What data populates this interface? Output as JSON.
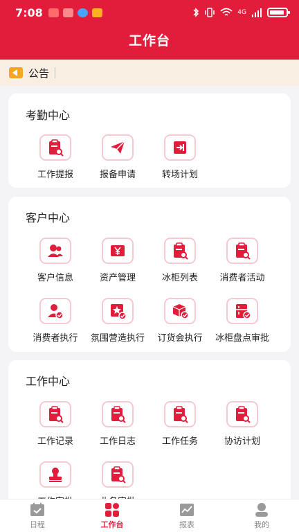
{
  "status": {
    "time": "7:08",
    "network": "4G"
  },
  "header": {
    "title": "工作台"
  },
  "notice": {
    "label": "公告"
  },
  "sections": {
    "attendance": {
      "title": "考勤中心",
      "items": [
        {
          "label": "工作提报",
          "icon": "clipboard-search-icon"
        },
        {
          "label": "报备申请",
          "icon": "paper-plane-icon"
        },
        {
          "label": "转场计划",
          "icon": "transfer-door-icon"
        }
      ]
    },
    "customer": {
      "title": "客户中心",
      "items": [
        {
          "label": "客户信息",
          "icon": "users-icon"
        },
        {
          "label": "资产管理",
          "icon": "yen-asset-icon"
        },
        {
          "label": "冰柜列表",
          "icon": "clipboard-search-icon"
        },
        {
          "label": "消费者活动",
          "icon": "clipboard-search-icon"
        },
        {
          "label": "消费者执行",
          "icon": "user-check-icon"
        },
        {
          "label": "氛围营造执行",
          "icon": "star-check-icon"
        },
        {
          "label": "订货会执行",
          "icon": "box-check-icon"
        },
        {
          "label": "冰柜盘点审批",
          "icon": "fridge-check-icon"
        }
      ]
    },
    "work": {
      "title": "工作中心",
      "items": [
        {
          "label": "工作记录",
          "icon": "clipboard-search-icon"
        },
        {
          "label": "工作日志",
          "icon": "clipboard-search-icon"
        },
        {
          "label": "工作任务",
          "icon": "clipboard-search-icon"
        },
        {
          "label": "协访计划",
          "icon": "clipboard-search-icon"
        },
        {
          "label": "工作审批",
          "icon": "stamp-icon"
        },
        {
          "label": "业务审批",
          "icon": "clipboard-search-icon"
        }
      ]
    }
  },
  "tabs": [
    {
      "label": "日程",
      "icon": "calendar-check-icon"
    },
    {
      "label": "工作台",
      "icon": "grid-icon"
    },
    {
      "label": "报表",
      "icon": "chart-icon"
    },
    {
      "label": "我的",
      "icon": "user-icon"
    }
  ],
  "colors": {
    "brand": "#e21d3c",
    "icon_border": "#f6c9d0",
    "notice_bg": "#f8efe2"
  }
}
